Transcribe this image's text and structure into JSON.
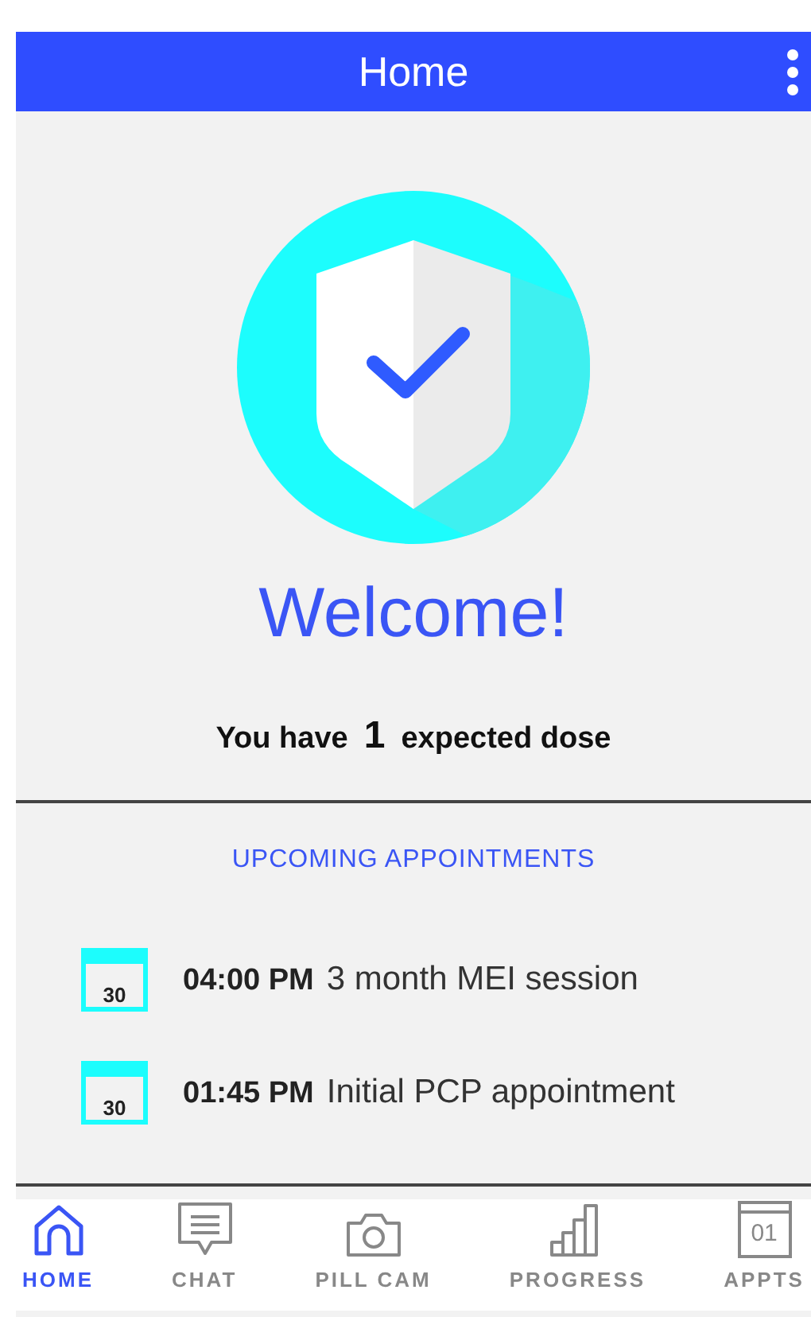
{
  "header": {
    "title": "Home"
  },
  "welcome": {
    "title": "Welcome!",
    "dose_prefix": "You have",
    "dose_count": "1",
    "dose_suffix": "expected dose"
  },
  "appointments": {
    "heading": "UPCOMING APPOINTMENTS",
    "items": [
      {
        "day": "30",
        "time": "04:00 PM",
        "title": "3 month MEI session"
      },
      {
        "day": "30",
        "time": "01:45 PM",
        "title": "Initial PCP appointment"
      }
    ]
  },
  "nav": [
    {
      "kind": "home",
      "label": "HOME",
      "selected": true
    },
    {
      "kind": "chat",
      "label": "CHAT",
      "selected": false
    },
    {
      "kind": "camera",
      "label": "PILL CAM",
      "selected": false
    },
    {
      "kind": "progress",
      "label": "PROGRESS",
      "selected": false
    },
    {
      "kind": "calendar",
      "label": "APPTS",
      "icon_text": "01",
      "selected": false
    }
  ]
}
